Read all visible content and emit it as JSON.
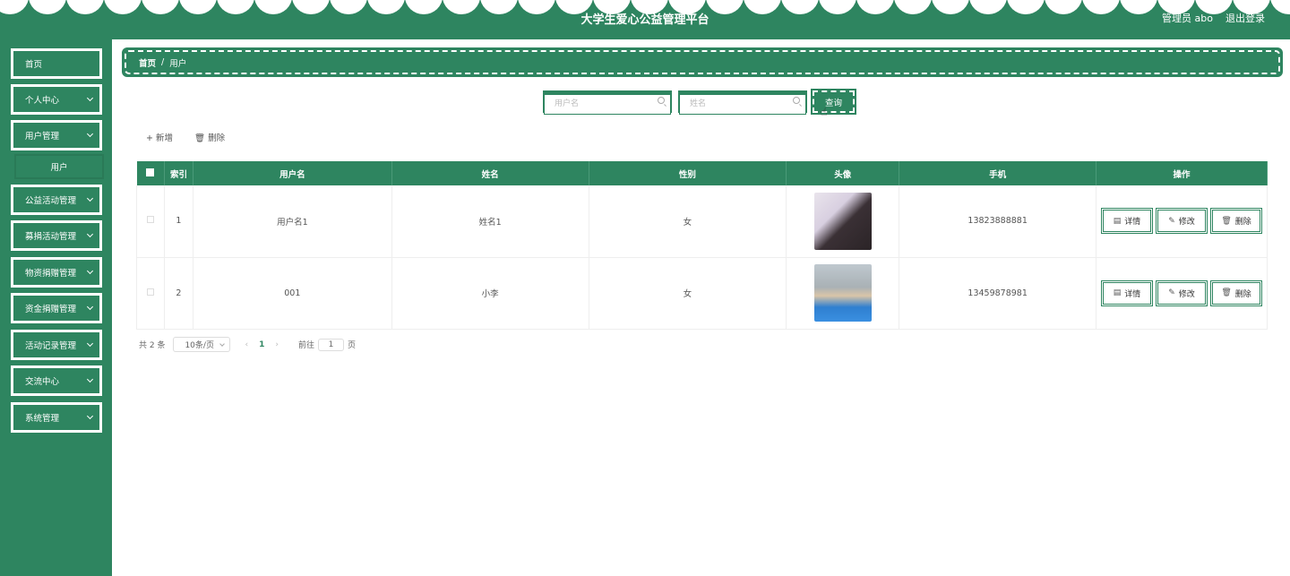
{
  "header": {
    "title": "大学生爱心公益管理平台",
    "user": "管理员 abo",
    "logout": "退出登录"
  },
  "sidebar": {
    "items": [
      {
        "label": "首页",
        "has_children": false
      },
      {
        "label": "个人中心",
        "has_children": true
      },
      {
        "label": "用户管理",
        "has_children": true
      },
      {
        "label": "公益活动管理",
        "has_children": true
      },
      {
        "label": "募捐活动管理",
        "has_children": true
      },
      {
        "label": "物资捐赠管理",
        "has_children": true
      },
      {
        "label": "资金捐赠管理",
        "has_children": true
      },
      {
        "label": "活动记录管理",
        "has_children": true
      },
      {
        "label": "交流中心",
        "has_children": true
      },
      {
        "label": "系统管理",
        "has_children": true
      }
    ],
    "sub_item": "用户"
  },
  "breadcrumb": {
    "home": "首页",
    "separator": "/",
    "current": "用户"
  },
  "search": {
    "username_placeholder": "用户名",
    "name_placeholder": "姓名",
    "query_label": "查询"
  },
  "actions": {
    "add": "+ 新增",
    "delete": "🗑 删除"
  },
  "table": {
    "columns": [
      "索引",
      "用户名",
      "姓名",
      "性别",
      "头像",
      "手机",
      "操作"
    ],
    "rows": [
      {
        "index": "1",
        "username": "用户名1",
        "name": "姓名1",
        "gender": "女",
        "phone": "13823888881"
      },
      {
        "index": "2",
        "username": "001",
        "name": "小李",
        "gender": "女",
        "phone": "13459878981"
      }
    ],
    "ops": {
      "detail": "详情",
      "edit": "修改",
      "remove": "删除"
    }
  },
  "pagination": {
    "total": "共 2 条",
    "page_size": "10条/页",
    "prev": "‹",
    "current": "1",
    "next": "›",
    "goto": "前往",
    "goto_value": "1",
    "unit": "页"
  },
  "colors": {
    "primary": "#2e8560"
  }
}
